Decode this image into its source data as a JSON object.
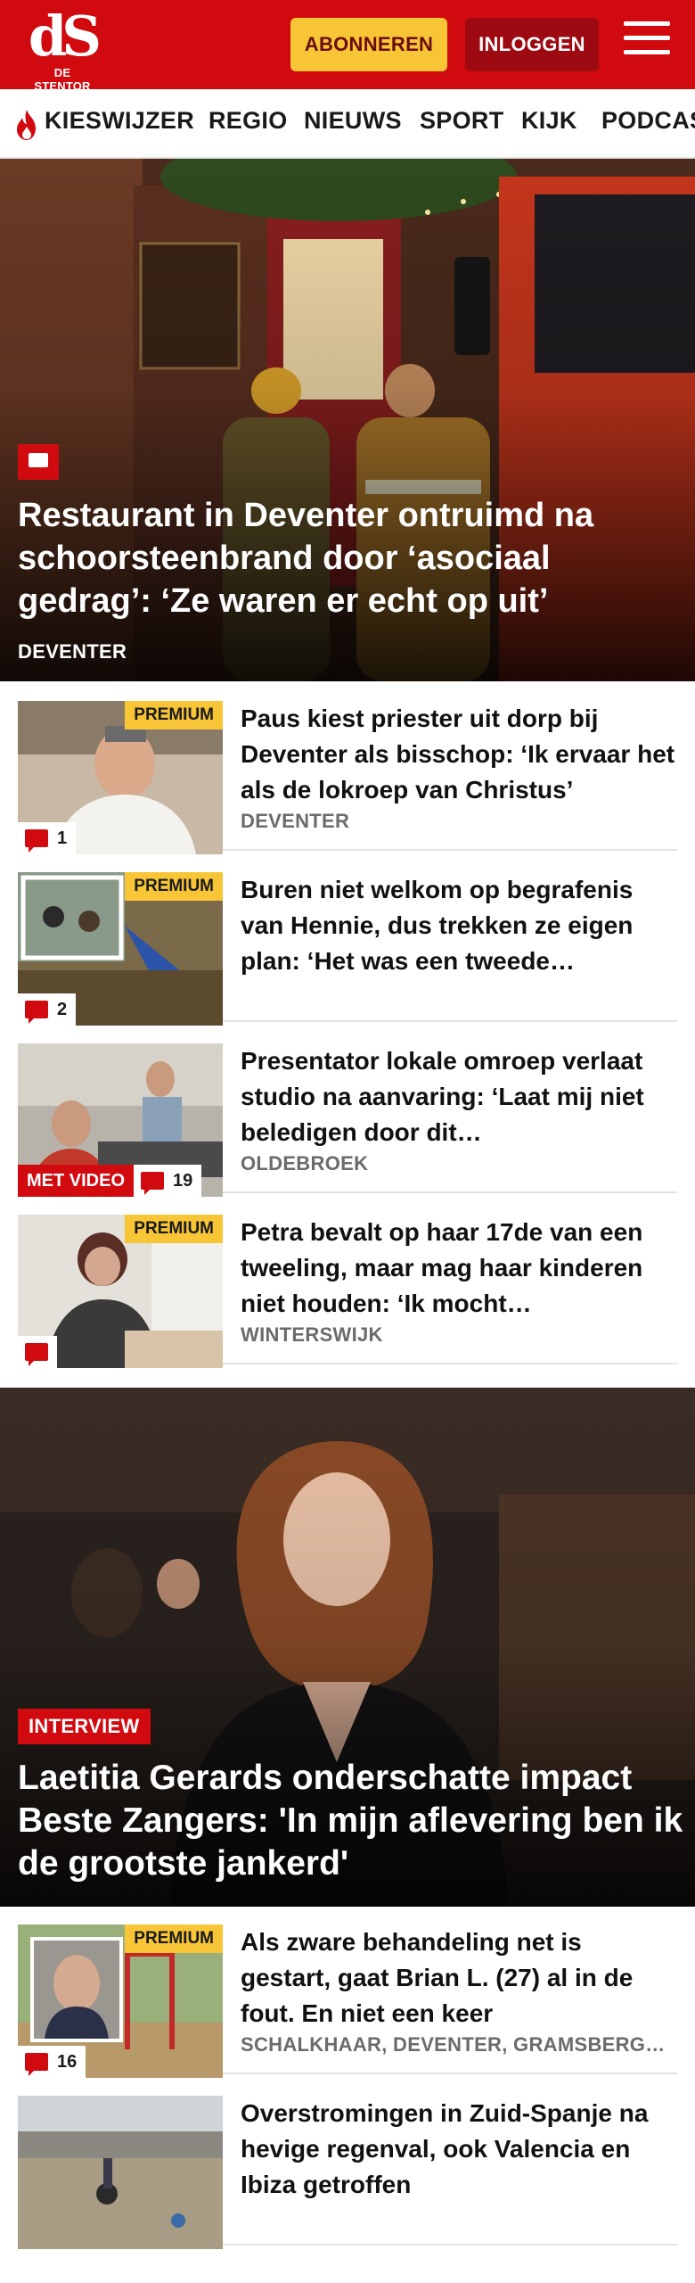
{
  "header": {
    "logo_mark": "dS",
    "logo_sub": "DE STENTOR",
    "subscribe_label": "ABONNEREN",
    "login_label": "INLOGGEN",
    "menu_icon": "hamburger-icon",
    "brand_color": "#d10a10",
    "accent_color": "#f7c536"
  },
  "nav": {
    "items": [
      "KIESWIJZER",
      "REGIO",
      "NIEUWS",
      "SPORT",
      "KIJK",
      "PODCAST"
    ],
    "first_item_icon": "flame-icon"
  },
  "hero": {
    "title": "Restaurant in Deventer ontruimd na schoorsteenbrand door ‘asociaal gedrag’: ‘Ze waren er echt op uit’",
    "region": "DEVENTER",
    "comment_icon": "comment-icon"
  },
  "articles": [
    {
      "title": "Paus kiest priester uit dorp bij Deventer als bisschop: ‘Ik ervaar het als de lokroep van Christus’",
      "region": "DEVENTER",
      "premium": "PREMIUM",
      "comments": "1",
      "video": ""
    },
    {
      "title": "Buren niet welkom op begrafenis van Hennie, dus trekken ze eigen plan: ‘Het was een tweede…",
      "region": "",
      "premium": "PREMIUM",
      "comments": "2",
      "video": ""
    },
    {
      "title": "Presentator lokale omroep verlaat studio na aanvaring: ‘Laat mij niet beledigen door dit…",
      "region": "OLDEBROEK",
      "premium": "",
      "comments": "19",
      "video": "MET VIDEO"
    },
    {
      "title": "Petra bevalt op haar 17de van een tweeling, maar mag haar kinderen niet houden: ‘Ik mocht…",
      "region": "WINTERSWIJK",
      "premium": "PREMIUM",
      "comments": "",
      "video": ""
    }
  ],
  "feature": {
    "label": "INTERVIEW",
    "title": "Laetitia Gerards onderschatte impact Beste Zangers: 'In mijn aflevering ben ik de grootste jankerd'"
  },
  "articles2": [
    {
      "title": "Als zware behandeling net is gestart, gaat Brian L. (27) al in de fout. En niet een keer",
      "region": "SCHALKHAAR, DEVENTER, GRAMSBERGEN",
      "premium": "PREMIUM",
      "comments": "16"
    },
    {
      "title": "Overstromingen in Zuid-Spanje na hevige regenval, ook Valencia en Ibiza getroffen",
      "region": "",
      "premium": "",
      "comments": ""
    }
  ]
}
